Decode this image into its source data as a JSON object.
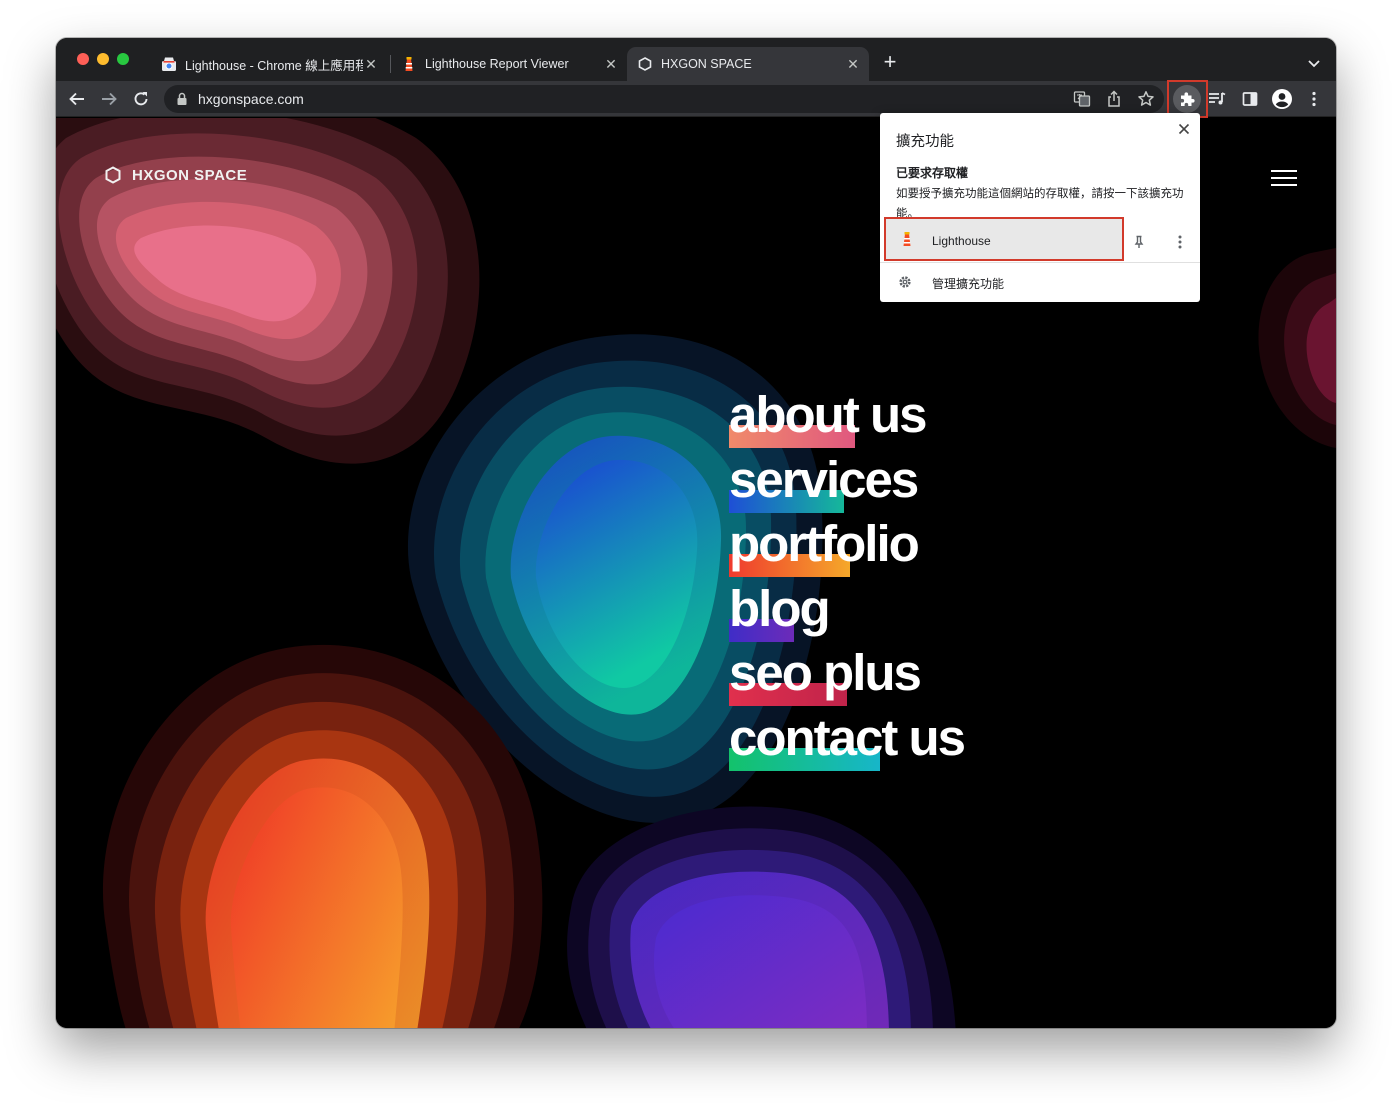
{
  "browser": {
    "tabs": [
      {
        "title": "Lighthouse - Chrome 線上應用程式商店",
        "close": "✕"
      },
      {
        "title": "Lighthouse Report Viewer",
        "close": "✕"
      },
      {
        "title": "HXGON SPACE",
        "close": "✕"
      }
    ],
    "new_tab": "+",
    "url": "hxgonspace.com"
  },
  "site": {
    "logo_text": "HXGON SPACE",
    "nav": [
      {
        "label": "about us",
        "highlight_from": "#f08a6a",
        "highlight_to": "#e0587f",
        "highlight_width": 126
      },
      {
        "label": "services",
        "highlight_from": "#1e4fd6",
        "highlight_to": "#15b89a",
        "highlight_width": 115
      },
      {
        "label": "portfolio",
        "highlight_from": "#ef3a2e",
        "highlight_to": "#f5a82a",
        "highlight_width": 121
      },
      {
        "label": "blog",
        "highlight_from": "#3f2dc7",
        "highlight_to": "#6c2bb9",
        "highlight_width": 65
      },
      {
        "label": "seo plus",
        "highlight_from": "#e0304d",
        "highlight_to": "#c0234a",
        "highlight_width": 118
      },
      {
        "label": "contact us",
        "highlight_from": "#13c26b",
        "highlight_to": "#17b6c9",
        "highlight_width": 151
      }
    ]
  },
  "extensions_popup": {
    "title": "擴充功能",
    "section_title": "已要求存取權",
    "description": "如要授予擴充功能這個網站的存取權，請按一下該擴充功能。",
    "extension_name": "Lighthouse",
    "manage_label": "管理擴充功能"
  },
  "colors": {
    "accent_highlight_box": "#d23a2b",
    "tab_active": "#35363a",
    "tab_strip": "#1f2022"
  }
}
